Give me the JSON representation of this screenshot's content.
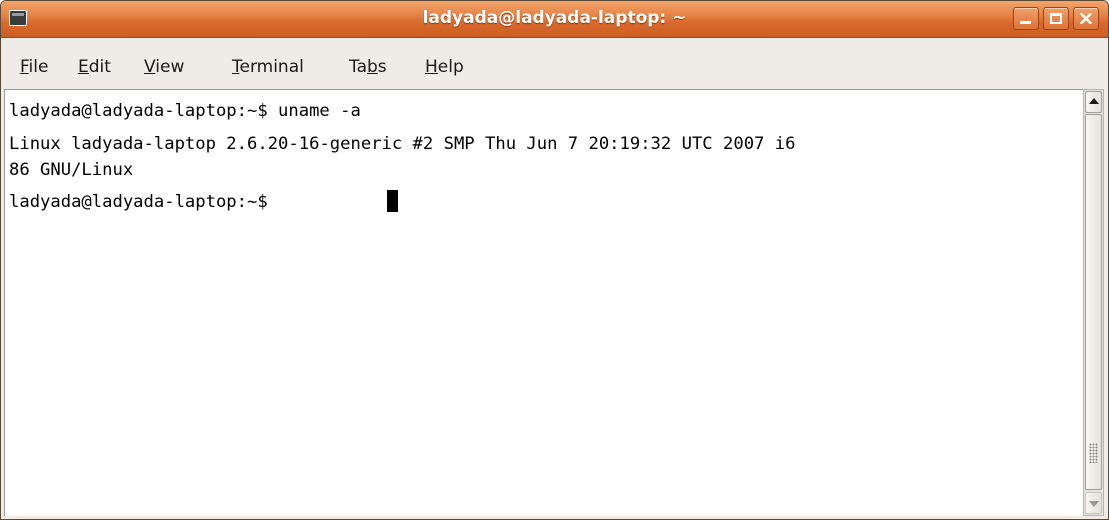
{
  "window": {
    "title": "ladyada@ladyada-laptop: ~",
    "app_icon": "terminal-icon",
    "controls": [
      "minimize-icon",
      "maximize-icon",
      "close-icon"
    ],
    "accent_color": "#e07a3f"
  },
  "menu": {
    "items": [
      {
        "label": "File",
        "mnemonic": "F"
      },
      {
        "label": "Edit",
        "mnemonic": "E"
      },
      {
        "label": "View",
        "mnemonic": "V"
      },
      {
        "label": "Terminal",
        "mnemonic": "T"
      },
      {
        "label": "Tabs",
        "mnemonic": "b"
      },
      {
        "label": "Help",
        "mnemonic": "H"
      }
    ]
  },
  "terminal": {
    "lines": [
      "ladyada@ladyada-laptop:~$ uname -a",
      "Linux ladyada-laptop 2.6.20-16-generic #2 SMP Thu Jun 7 20:19:32 UTC 2007 i6",
      "86 GNU/Linux",
      "ladyada@ladyada-laptop:~$ "
    ]
  }
}
